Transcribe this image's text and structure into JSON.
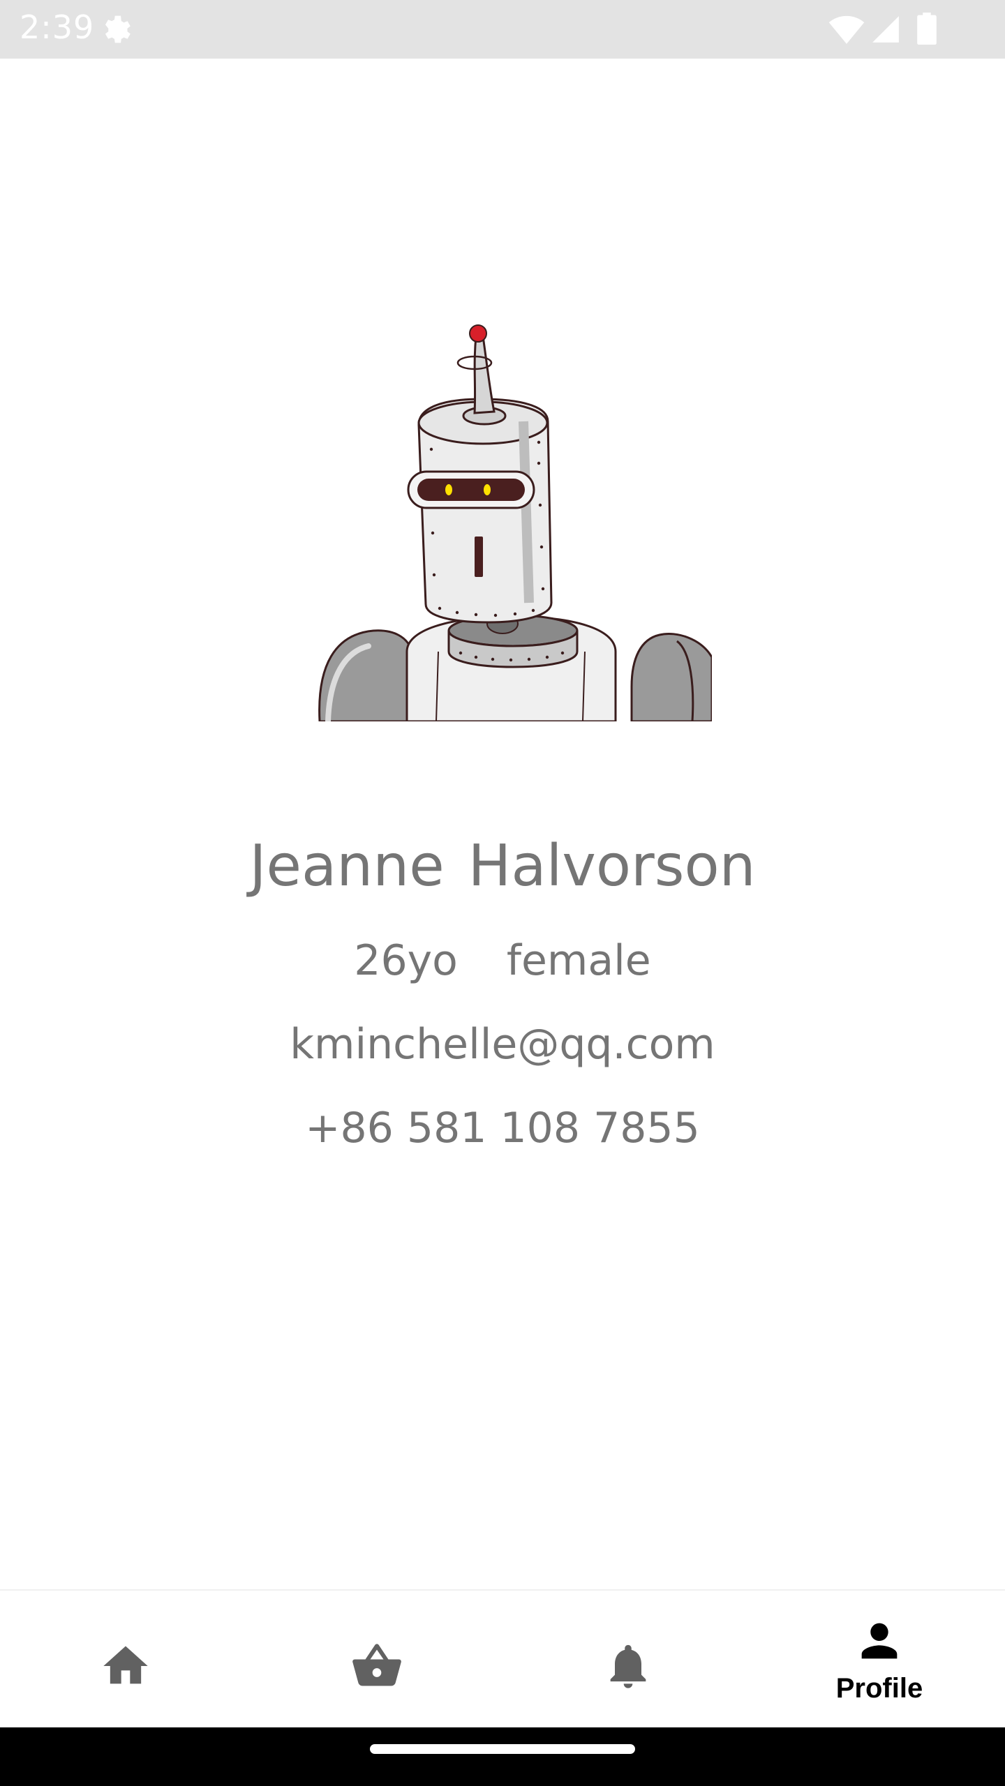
{
  "status_bar": {
    "time": "2:39",
    "icons": [
      "gear-icon",
      "wifi-icon",
      "signal-icon",
      "battery-icon"
    ],
    "background": "#e3e3e3"
  },
  "profile": {
    "avatar_icon": "robot-avatar",
    "first_name": "Jeanne",
    "last_name": "Halvorson",
    "age": "26yo",
    "gender": "female",
    "email": "kminchelle@qq.com",
    "phone": "+86 581 108 7855",
    "text_color": "#757575"
  },
  "bottom_nav": {
    "items": [
      {
        "icon": "home-icon",
        "label": ""
      },
      {
        "icon": "basket-icon",
        "label": ""
      },
      {
        "icon": "bell-icon",
        "label": ""
      },
      {
        "icon": "person-icon",
        "label": "Profile"
      }
    ],
    "active_index": 3,
    "active_color": "#000000",
    "inactive_color": "#616161"
  }
}
